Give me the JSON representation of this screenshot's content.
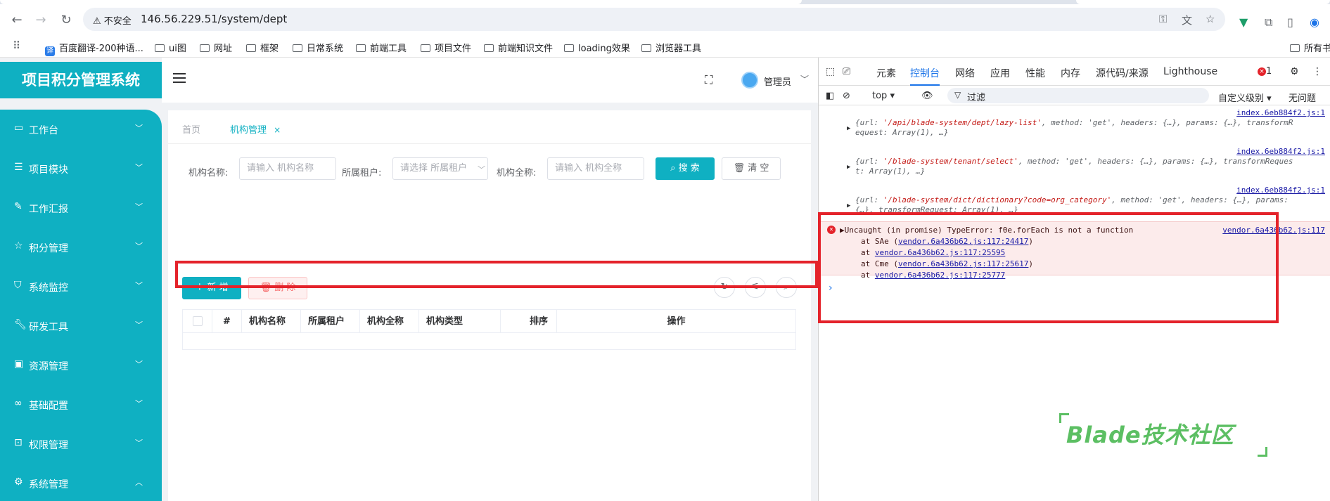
{
  "browser": {
    "address": {
      "security_label": "不安全",
      "url": "146.56.229.51/system/dept"
    },
    "bookmarks": [
      {
        "label": "百度翻译-200种语...",
        "icon": "translate-icon"
      },
      {
        "label": "ui图",
        "icon": "folder-icon"
      },
      {
        "label": "网址",
        "icon": "folder-icon"
      },
      {
        "label": "框架",
        "icon": "folder-icon"
      },
      {
        "label": "日常系统",
        "icon": "folder-icon"
      },
      {
        "label": "前端工具",
        "icon": "folder-icon"
      },
      {
        "label": "项目文件",
        "icon": "folder-icon"
      },
      {
        "label": "前端知识文件",
        "icon": "folder-icon"
      },
      {
        "label": "loading效果",
        "icon": "folder-icon"
      },
      {
        "label": "浏览器工具",
        "icon": "folder-icon"
      },
      {
        "label": "所有书",
        "icon": "folder-icon"
      }
    ]
  },
  "app": {
    "title": "项目积分管理系统",
    "user_name": "管理员",
    "brand_color": "#0fb0c2",
    "sidebar": {
      "items": [
        {
          "label": "工作台",
          "icon": "monitor-icon"
        },
        {
          "label": "项目模块",
          "icon": "list-icon"
        },
        {
          "label": "工作汇报",
          "icon": "edit-icon"
        },
        {
          "label": "积分管理",
          "icon": "star-icon"
        },
        {
          "label": "系统监控",
          "icon": "shield-icon"
        },
        {
          "label": "研发工具",
          "icon": "wrench-icon"
        },
        {
          "label": "资源管理",
          "icon": "wallet-icon"
        },
        {
          "label": "基础配置",
          "icon": "link-icon"
        },
        {
          "label": "权限管理",
          "icon": "lock-icon"
        },
        {
          "label": "系统管理",
          "icon": "gear-icon"
        }
      ]
    },
    "page_tabs": [
      {
        "label": "首页",
        "active": false
      },
      {
        "label": "机构管理",
        "active": true,
        "close": "×"
      }
    ],
    "search": {
      "name_label": "机构名称:",
      "name_placeholder": "请输入 机构名称",
      "tenant_label": "所属租户:",
      "tenant_placeholder": "请选择 所属租户",
      "fullname_label": "机构全称:",
      "fullname_placeholder": "请输入 机构全称",
      "search_button": "搜 索",
      "clear_button": "清 空"
    },
    "actions": {
      "add_button": "新 增",
      "delete_button": "删 除"
    },
    "table": {
      "columns": [
        "#",
        "机构名称",
        "所属租户",
        "机构全称",
        "机构类型",
        "排序",
        "操作"
      ],
      "rows": []
    }
  },
  "devtools": {
    "tabs": [
      "元素",
      "控制台",
      "网络",
      "应用",
      "性能",
      "内存",
      "源代码/来源",
      "Lighthouse"
    ],
    "active_tab": "控制台",
    "error_count": "1",
    "filter": {
      "context": "top",
      "placeholder": "过滤",
      "level": "自定义级别",
      "issues": "无问题"
    },
    "logs": [
      {
        "source": "index.6eb884f2.js:1",
        "line1_pre": "{url: ",
        "url": "'/api/blade-system/dept/lazy-list'",
        "line1_post": ", method: 'get', headers: {…}, params: {…}, transformR",
        "line2": "equest: Array(1),  …}"
      },
      {
        "source": "index.6eb884f2.js:1",
        "line1_pre": "{url: ",
        "url": "'/blade-system/tenant/select'",
        "line1_post": ", method: 'get', headers: {…}, params: {…}, transformReques",
        "line2": "t: Array(1),  …}"
      },
      {
        "source": "index.6eb884f2.js:1",
        "line1_pre": "{url: ",
        "url": "'/blade-system/dict/dictionary?code=org_category'",
        "line1_post": ", method: 'get', headers: {…}, params:",
        "line2": "{…}, transformRequest: Array(1),  …}"
      }
    ],
    "error": {
      "message": "Uncaught (in promise) TypeError: f0e.forEach is not a function",
      "source": "vendor.6a436b62.js:117",
      "stack": [
        {
          "fn": "at SAe (",
          "link": "vendor.6a436b62.js:117:24417",
          "end": ")"
        },
        {
          "fn": "at ",
          "link": "vendor.6a436b62.js:117:25595",
          "end": ""
        },
        {
          "fn": "at Cme (",
          "link": "vendor.6a436b62.js:117:25617",
          "end": ")"
        },
        {
          "fn": "at ",
          "link": "vendor.6a436b62.js:117:25777",
          "end": ""
        }
      ]
    },
    "prompt": "›"
  },
  "watermark": "Blade技术社区",
  "annotation_color": "#e4232b"
}
